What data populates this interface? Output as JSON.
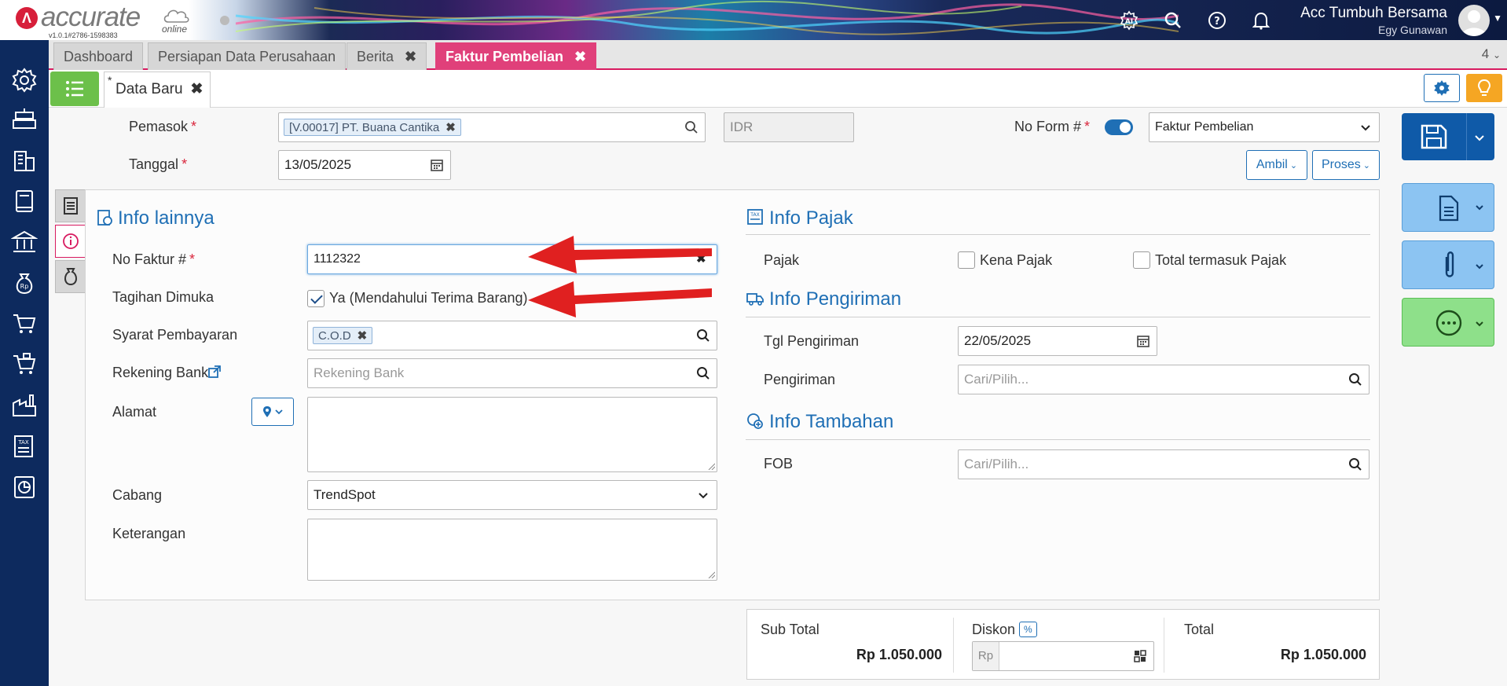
{
  "header": {
    "logo_text": "accurate",
    "logo_sub": "online",
    "version": "v1.0.1#2786-1598383",
    "company_name": "Acc Tumbuh Bersama",
    "user_name": "Egy Gunawan",
    "icons": [
      "ai-icon",
      "search-icon",
      "help-icon",
      "bell-icon"
    ]
  },
  "tabs": [
    {
      "label": "Dashboard",
      "closable": false,
      "active": false
    },
    {
      "label": "Persiapan Data Perusahaan",
      "closable": false,
      "active": false
    },
    {
      "label": "Berita",
      "closable": true,
      "active": false
    },
    {
      "label": "Faktur Pembelian",
      "closable": true,
      "active": true
    }
  ],
  "tab_count": "4",
  "doc_tab": {
    "star": "*",
    "label": "Data Baru"
  },
  "form": {
    "pemasok_label": "Pemasok",
    "pemasok_chip": "[V.00017] PT. Buana Cantika",
    "currency": "IDR",
    "no_form_label": "No Form #",
    "form_type": "Faktur Pembelian",
    "tanggal_label": "Tanggal",
    "tanggal_value": "13/05/2025",
    "ambil_label": "Ambil",
    "proses_label": "Proses",
    "required_mark": "*"
  },
  "info_lainnya": {
    "title": "Info lainnya",
    "no_faktur_label": "No Faktur #",
    "no_faktur_value": "1112322",
    "tagihan_label": "Tagihan Dimuka",
    "tagihan_checkbox_label": "Ya (Mendahului Terima Barang)",
    "tagihan_checked": true,
    "syarat_label": "Syarat Pembayaran",
    "syarat_chip": "C.O.D",
    "rekening_label": "Rekening Bank",
    "rekening_placeholder": "Rekening Bank",
    "alamat_label": "Alamat",
    "cabang_label": "Cabang",
    "cabang_value": "TrendSpot",
    "keterangan_label": "Keterangan"
  },
  "info_pajak": {
    "title": "Info Pajak",
    "pajak_label": "Pajak",
    "kena_pajak_label": "Kena Pajak",
    "total_termasuk_label": "Total termasuk Pajak"
  },
  "info_pengiriman": {
    "title": "Info Pengiriman",
    "tgl_label": "Tgl Pengiriman",
    "tgl_value": "22/05/2025",
    "pengiriman_label": "Pengiriman",
    "pengiriman_placeholder": "Cari/Pilih..."
  },
  "info_tambahan": {
    "title": "Info Tambahan",
    "fob_label": "FOB",
    "fob_placeholder": "Cari/Pilih..."
  },
  "totals": {
    "sub_total_label": "Sub Total",
    "sub_total_value": "Rp 1.050.000",
    "diskon_label": "Diskon",
    "diskon_badge": "%",
    "diskon_prefix": "Rp",
    "total_label": "Total",
    "total_value": "Rp 1.050.000"
  },
  "colors": {
    "accent_blue": "#1f6fb5",
    "active_tab": "#e0407a",
    "sidebar": "#0d2a5e",
    "list_button": "#6cc04a",
    "bulb_button": "#f5a623",
    "annotation_arrow": "#e02020"
  }
}
